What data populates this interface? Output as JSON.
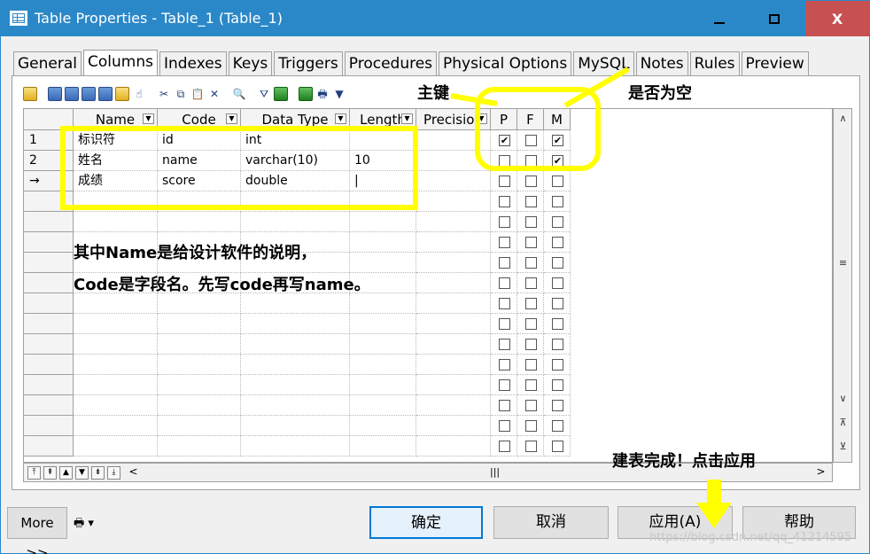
{
  "window": {
    "title": "Table Properties - Table_1 (Table_1)",
    "close_glyph": "X"
  },
  "tabs": [
    {
      "label": "General"
    },
    {
      "label": "Columns"
    },
    {
      "label": "Indexes"
    },
    {
      "label": "Keys"
    },
    {
      "label": "Triggers"
    },
    {
      "label": "Procedures"
    },
    {
      "label": "Physical Options"
    },
    {
      "label": "MySQL"
    },
    {
      "label": "Notes"
    },
    {
      "label": "Rules"
    },
    {
      "label": "Preview"
    }
  ],
  "active_tab": "Columns",
  "grid": {
    "headers": [
      "Name",
      "Code",
      "Data Type",
      "Length",
      "Precision",
      "P",
      "F",
      "M"
    ],
    "rows": [
      {
        "num": "1",
        "name": "标识符",
        "code": "id",
        "type": "int",
        "length": "",
        "p": true,
        "f": false,
        "m": true
      },
      {
        "num": "2",
        "name": "姓名",
        "code": "name",
        "type": "varchar(10)",
        "length": "10",
        "p": false,
        "f": false,
        "m": true
      },
      {
        "num": "→",
        "name": "成绩",
        "code": "score",
        "type": "double",
        "length": "|",
        "p": false,
        "f": false,
        "m": false
      }
    ]
  },
  "buttons": {
    "more": "More >>",
    "ok": "确定",
    "cancel": "取消",
    "apply": "应用(A)",
    "help": "帮助"
  },
  "annotations": {
    "primary_key": "主键",
    "nullable": "是否为空",
    "note_line1": "其中Name是给设计软件的说明，",
    "note_line2": "Code是字段名。先写code再写name。",
    "done": "建表完成！点击应用"
  },
  "watermark": "https://blog.csdn.net/qq_41214595",
  "colors": {
    "titlebar": "#2b88c8",
    "highlight": "#ffff00",
    "close": "#c75050"
  }
}
